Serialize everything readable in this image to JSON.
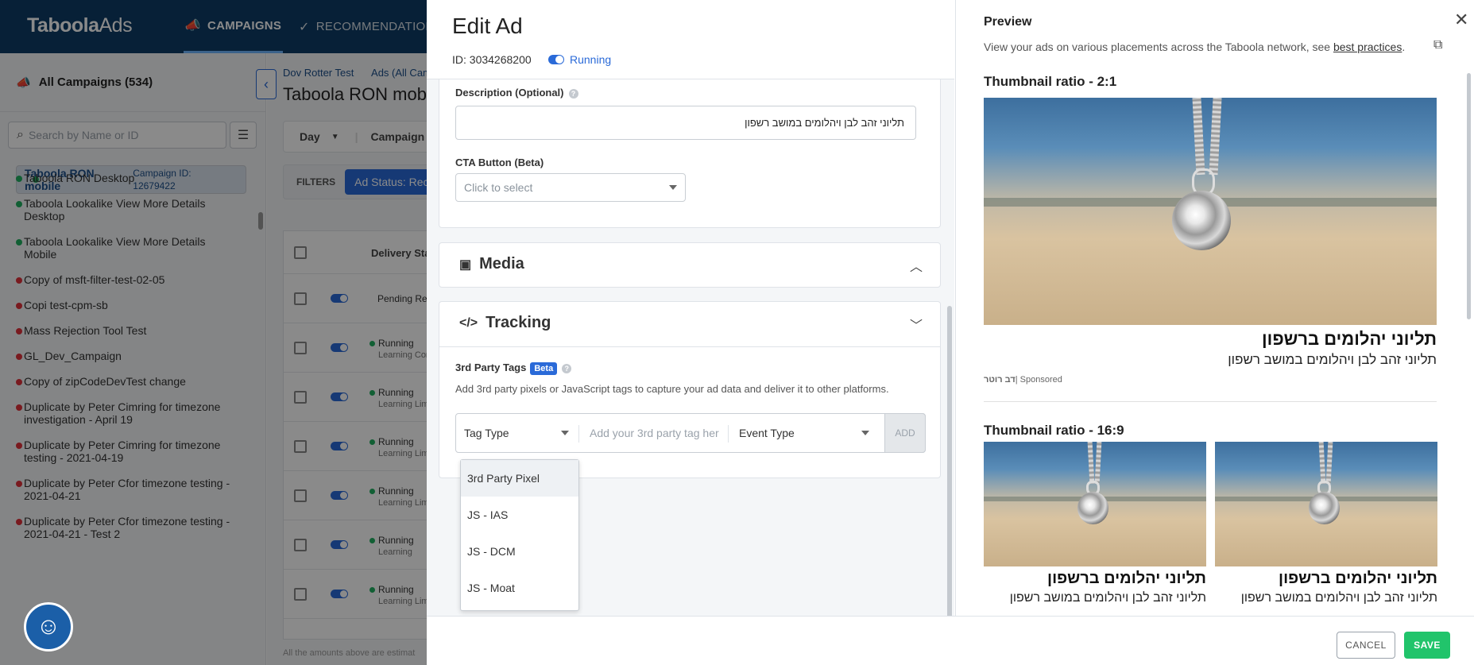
{
  "app": {
    "logo": "Taboola",
    "logo_suffix": "Ads",
    "nav": [
      {
        "label": "CAMPAIGNS",
        "icon": "megaphone-icon"
      },
      {
        "label": "RECOMMENDATIONS",
        "icon": "check-circle-icon"
      }
    ]
  },
  "sidebar": {
    "all_campaigns": "All Campaigns",
    "count": "(534)",
    "search_placeholder": "Search by Name or ID",
    "items": [
      {
        "name": "Taboola RON mobile",
        "sub": "Campaign ID: 12679422",
        "status": "green",
        "selected": true
      },
      {
        "name": "Taboola RON Desktop",
        "status": "green"
      },
      {
        "name": "Taboola Lookalike View More Details Desktop",
        "status": "green"
      },
      {
        "name": "Taboola Lookalike View More Details Mobile",
        "status": "green"
      },
      {
        "name": "Copy of msft-filter-test-02-05",
        "status": "red"
      },
      {
        "name": "Copi test-cpm-sb",
        "status": "red"
      },
      {
        "name": "Mass Rejection Tool Test",
        "status": "red"
      },
      {
        "name": "GL_Dev_Campaign",
        "status": "red"
      },
      {
        "name": "Copy of zipCodeDevTest change",
        "status": "red"
      },
      {
        "name": "Duplicate by Peter Cimring for timezone investigation - April 19",
        "status": "red"
      },
      {
        "name": "Duplicate by Peter Cimring for timezone testing - 2021-04-19",
        "status": "red"
      },
      {
        "name": "Duplicate by Peter Cfor timezone testing - 2021-04-21",
        "status": "red"
      },
      {
        "name": "Duplicate by Peter Cfor timezone testing - 2021-04-21 - Test 2",
        "status": "red"
      }
    ]
  },
  "main": {
    "breadcrumb": [
      "Dov Rotter Test",
      "Ads (All Camp"
    ],
    "title": "Taboola RON mobile",
    "granularity": "Day",
    "campaign_label": "Campaign G",
    "filters_label": "FILTERS",
    "filter_chip": "Ad Status: Rece",
    "column_header": "Delivery Stat",
    "rows": [
      {
        "status": "Pending Rev",
        "sub": ""
      },
      {
        "status": "Running",
        "sub": "Learning Com"
      },
      {
        "status": "Running",
        "sub": "Learning Lim"
      },
      {
        "status": "Running",
        "sub": "Learning Lim"
      },
      {
        "status": "Running",
        "sub": "Learning Lim"
      },
      {
        "status": "Running",
        "sub": "Learning"
      },
      {
        "status": "Running",
        "sub": "Learning Lim"
      }
    ],
    "footnote": "All the amounts above are estimat"
  },
  "edit": {
    "title": "Edit Ad",
    "id_text": "ID: 3034268200",
    "status": "Running",
    "description_label": "Description (Optional)",
    "description_value": "תליוני זהב לבן ויהלומים במושב רשפון",
    "cta_label": "CTA Button (Beta)",
    "cta_placeholder": "Click to select",
    "media_label": "Media",
    "tracking_label": "Tracking",
    "third_party_label": "3rd Party Tags",
    "beta": "Beta",
    "third_party_desc": "Add 3rd party pixels or JavaScript tags to capture your ad data and deliver it to other platforms.",
    "tag_type_placeholder": "Tag Type",
    "tag_input_placeholder": "Add your 3rd party tag her",
    "event_type_placeholder": "Event Type",
    "add_label": "ADD",
    "tag_type_options": [
      "3rd Party Pixel",
      "JS - IAS",
      "JS - DCM",
      "JS - Moat"
    ]
  },
  "preview": {
    "title": "Preview",
    "desc": "View your ads on various placements across the Taboola network, see",
    "link": "best practices",
    "period": ".",
    "ratio1": "Thumbnail ratio - 2:1",
    "ratio2": "Thumbnail ratio - 16:9",
    "ad_title": "תליוני יהלומים ברשפון",
    "ad_desc": "תליוני זהב לבן ויהלומים במושב רשפון",
    "brand": "דב רוטר",
    "sponsored": "| Sponsored"
  },
  "footer": {
    "cancel": "CANCEL",
    "save": "SAVE"
  },
  "colors": {
    "accent": "#2a6ad8",
    "topbar": "#0d3b66",
    "save": "#21c46b",
    "running": "#21b060",
    "paused": "#e0303a"
  }
}
